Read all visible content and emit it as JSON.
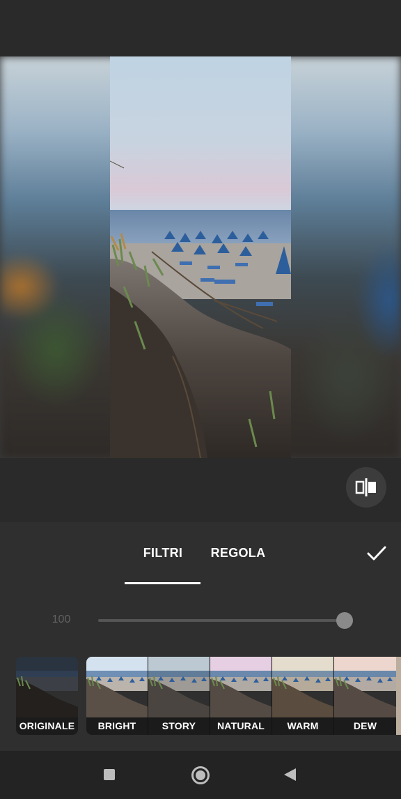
{
  "editor": {
    "tabs": [
      {
        "label": "FILTRI",
        "active": true
      },
      {
        "label": "REGOLA",
        "active": false
      }
    ],
    "strength_value": "100",
    "strength_level": 1.0
  },
  "filters": [
    {
      "label": "ORIGINALE"
    },
    {
      "label": "BRIGHT"
    },
    {
      "label": "STORY"
    },
    {
      "label": "NATURAL"
    },
    {
      "label": "WARM"
    },
    {
      "label": "DEW"
    }
  ],
  "icons": {
    "compare": "compare-split-icon",
    "confirm": "checkmark-icon",
    "nav_recent": "square-icon",
    "nav_home": "circle-icon",
    "nav_back": "triangle-back-icon"
  },
  "colors": {
    "background": "#2a2a2a",
    "panel": "#2f2f2f",
    "accent": "#ffffff",
    "muted_text": "#616161"
  }
}
